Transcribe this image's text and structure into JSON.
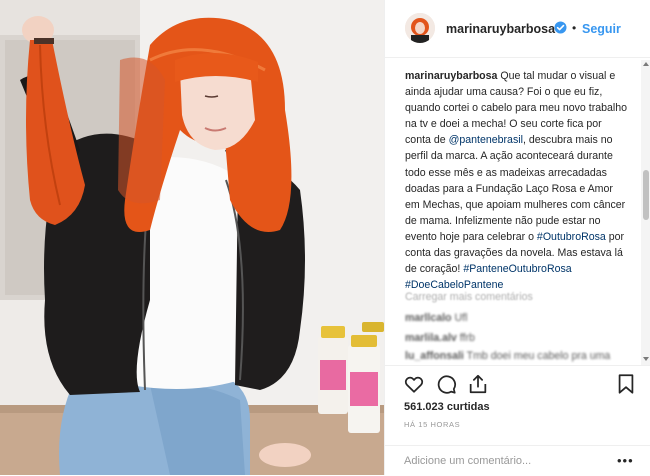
{
  "post": {
    "author": "marinaruybarbosa",
    "verified": true,
    "follow_label": "Seguir",
    "dot": "•",
    "photo_label": "",
    "caption": {
      "author": "marinaruybarbosa",
      "t1": " Que tal mudar o visual e ainda ajudar uma causa? Foi o que eu fiz, quando cortei o cabelo para meu novo trabalho na tv e doei a mecha! O seu corte fica por conta de ",
      "mention": "@pantenebrasil",
      "t2": ", descubra mais no perfil da marca. A ação aconteceará durante todo esse mês e as madeixas arrecadadas doadas para a Fundação Laço Rosa e Amor em Mechas, que apoiam mulheres com câncer de mama. Infelizmente não pude estar no evento hoje para celebrar o ",
      "hashtag1": "#OutubroRosa",
      "t3": " por conta das gravações da novela. Mas estava lá de coração! ",
      "hashtag2": "#PanteneOutubroRosa",
      "t4": " ",
      "hashtag3": "#DoeCabeloPantene"
    },
    "load_more": "Carregar mais comentários",
    "comments": [
      {
        "user": "marllcalo",
        "text": "Ufl"
      },
      {
        "user": "marlila.alv",
        "text": "ffrb"
      },
      {
        "user": "lu_affonsali",
        "text": "Tmb doei meu cabelo pra uma"
      }
    ],
    "likes_count": "561.023",
    "likes_label": "curtidas",
    "time": "HÁ 15 HORAS",
    "comment_placeholder": "Adicione um comentário...",
    "more": "•••",
    "icons": {
      "like": "heart-icon",
      "comment": "comment-icon",
      "share": "share-icon",
      "save": "bookmark-icon",
      "verified": "verified-badge-icon"
    },
    "colors": {
      "link": "#3897f0",
      "hashtag": "#003569",
      "muted": "#999999",
      "hair": "#e0521c"
    }
  }
}
